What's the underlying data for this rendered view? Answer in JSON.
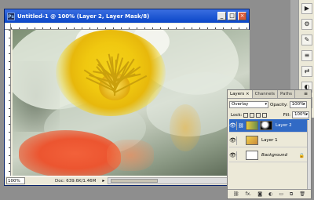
{
  "document": {
    "title": "Untitled-1 @ 100% (Layer 2, Layer Mask/8)",
    "app_icon": "Ps",
    "buttons": {
      "minimize": "_",
      "maximize": "□",
      "close": "×"
    },
    "status": {
      "zoom": "100%",
      "doc_info": "Doc: 639.6K/1.46M",
      "arrow": "▸"
    }
  },
  "layers_panel": {
    "tabs": [
      {
        "label": "Layers ×",
        "active": true
      },
      {
        "label": "Channels",
        "active": false
      },
      {
        "label": "Paths",
        "active": false
      }
    ],
    "menu_icon": "≡",
    "blend_mode": "Overlay",
    "opacity_label": "Opacity:",
    "opacity_value": "100%",
    "lock_label": "Lock:",
    "fill_label": "Fill:",
    "fill_value": "100%",
    "layers": [
      {
        "name": "Layer 2",
        "selected": true,
        "visible": true
      },
      {
        "name": "Layer 1",
        "selected": false,
        "visible": true
      },
      {
        "name": "Background",
        "selected": false,
        "visible": true,
        "italic": true,
        "locked": true
      }
    ],
    "bottom_buttons": [
      "link",
      "fx",
      "mask",
      "adjust",
      "group",
      "new",
      "delete"
    ]
  },
  "toolstrip": {
    "tools": [
      "▶",
      "⚙",
      "✎",
      "≡",
      "⇄",
      "◐",
      "⚑",
      "☰"
    ]
  },
  "colors": {
    "titlebar": "#0a46c8",
    "selection": "#316ac5",
    "background": "#8e8e8e"
  }
}
